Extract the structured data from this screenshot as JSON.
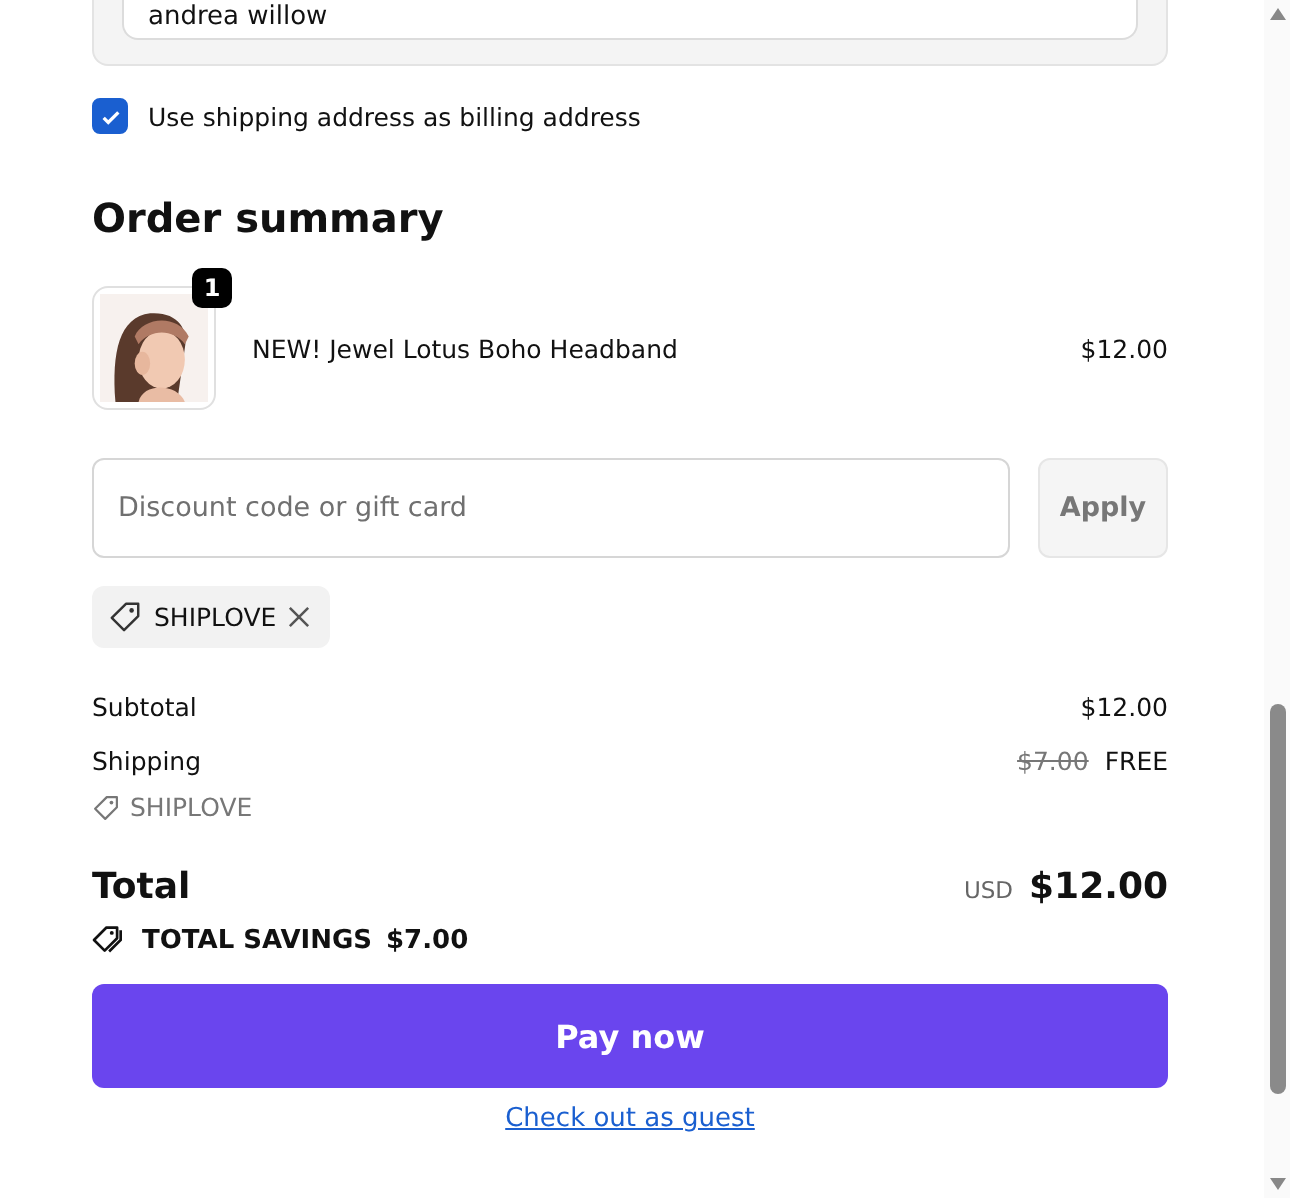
{
  "billing_name_field": {
    "value": "andrea willow"
  },
  "same_billing": {
    "label": "Use shipping address as billing address",
    "checked": true
  },
  "order_summary": {
    "title": "Order summary",
    "items": [
      {
        "quantity": "1",
        "name": "NEW! Jewel Lotus Boho Headband",
        "price": "$12.00"
      }
    ],
    "discount": {
      "placeholder": "Discount code or gift card",
      "apply_label": "Apply",
      "apply_disabled": true
    },
    "applied_codes": [
      {
        "code": "SHIPLOVE"
      }
    ],
    "subtotal": {
      "label": "Subtotal",
      "value": "$12.00"
    },
    "shipping": {
      "label": "Shipping",
      "original": "$7.00",
      "value": "FREE",
      "code": "SHIPLOVE"
    },
    "total": {
      "label": "Total",
      "currency": "USD",
      "value": "$12.00"
    },
    "savings": {
      "label": "TOTAL SAVINGS",
      "value": "$7.00"
    }
  },
  "pay_button": "Pay now",
  "guest_link": "Check out as guest"
}
